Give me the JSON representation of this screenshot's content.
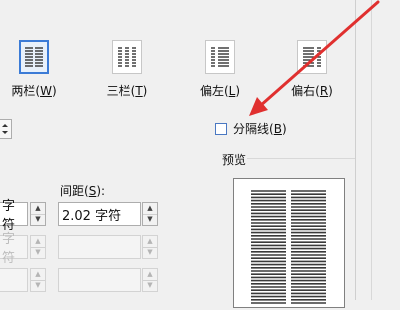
{
  "presets": [
    {
      "label": "两栏",
      "key": "W",
      "selected": true,
      "icon": "two-columns-icon"
    },
    {
      "label": "三栏",
      "key": "T",
      "selected": false,
      "icon": "three-columns-icon"
    },
    {
      "label": "偏左",
      "key": "L",
      "selected": false,
      "icon": "left-column-icon"
    },
    {
      "label": "偏右",
      "key": "R",
      "selected": false,
      "icon": "right-column-icon"
    }
  ],
  "line_between": {
    "label": "分隔线",
    "key": "B",
    "checked": false
  },
  "preview": {
    "label": "预览"
  },
  "spacing": {
    "label": "间距",
    "key": "S"
  },
  "width_column": {
    "row1_value": "字符",
    "row2_value": "字符"
  },
  "spacing_column": {
    "row1_value": "2.02 字符"
  },
  "colors": {
    "accent": "#3b7bd6",
    "annotation_arrow": "#e0302f"
  }
}
